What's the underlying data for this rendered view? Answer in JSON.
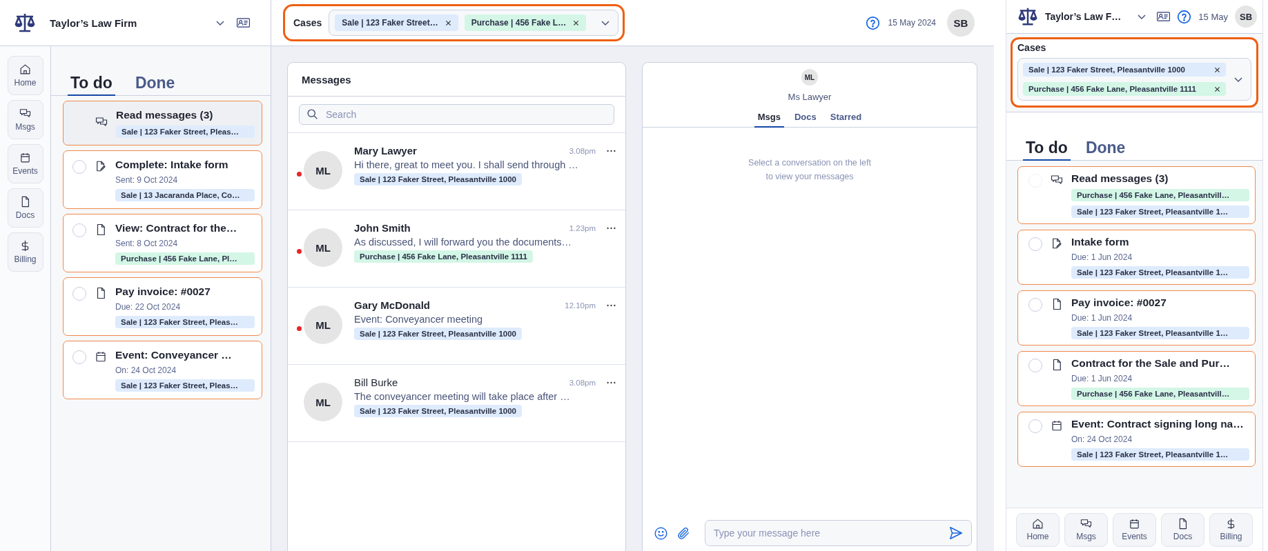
{
  "desktop": {
    "brand": {
      "name": "Taylor’s Law Firm"
    },
    "nav": [
      {
        "kind": "home",
        "label": "Home"
      },
      {
        "kind": "messages",
        "label": "Msgs"
      },
      {
        "kind": "events",
        "label": "Events"
      },
      {
        "kind": "docs",
        "label": "Docs"
      },
      {
        "kind": "billing",
        "label": "Billing"
      }
    ],
    "tabs": [
      {
        "label": "To do",
        "selected": true
      },
      {
        "label": "Done",
        "selected": false
      }
    ],
    "todos": [
      {
        "kind": "messages",
        "selected": true,
        "title": "Read messages (3)",
        "tags": [
          {
            "kind": "sale",
            "text": "Sale | 123 Faker Street, Pleas…"
          }
        ]
      },
      {
        "kind": "form",
        "selected": false,
        "title": "Complete: Intake form",
        "subtitle": "Sent: 9 Oct 2024",
        "tags": [
          {
            "kind": "sale",
            "text": "Sale | 13 Jacaranda Place, Co…"
          }
        ]
      },
      {
        "kind": "document",
        "selected": false,
        "title": "View: Contract for the…",
        "subtitle": "Sent: 8 Oct 2024",
        "tags": [
          {
            "kind": "purchase",
            "text": "Purchase | 456 Fake Lane, Pl…"
          }
        ]
      },
      {
        "kind": "document",
        "selected": false,
        "title": "Pay invoice: #0027",
        "subtitle": "Due: 22 Oct 2024",
        "tags": [
          {
            "kind": "sale",
            "text": "Sale | 123 Faker Street, Pleas…"
          }
        ]
      },
      {
        "kind": "event",
        "selected": false,
        "title": "Event: Conveyancer …",
        "subtitle": "On: 24 Oct 2024",
        "tags": [
          {
            "kind": "sale",
            "text": "Sale | 123 Faker Street, Pleas…"
          }
        ]
      }
    ],
    "cases": {
      "label": "Cases",
      "chips": [
        {
          "kind": "sale",
          "text": "Sale | 123 Faker Street…"
        },
        {
          "kind": "purchase",
          "text": "Purchase | 456 Fake L…"
        }
      ]
    },
    "date": "15 May 2024",
    "avatar": "SB",
    "messages": {
      "title": "Messages",
      "search": {
        "placeholder": "Search"
      },
      "conversations": [
        {
          "initials": "ML",
          "name": "Mary Lawyer",
          "unread": true,
          "time": "3.08pm",
          "preview": "Hi there, great to meet you. I shall send through …",
          "tag": {
            "kind": "sale",
            "text": "Sale | 123 Faker Street, Pleasantville 1000"
          }
        },
        {
          "initials": "ML",
          "name": "John Smith",
          "unread": true,
          "time": "1.23pm",
          "preview": "As discussed, I will forward you the documents…",
          "tag": {
            "kind": "purchase",
            "text": "Purchase | 456 Fake Lane, Pleasantville 1111"
          }
        },
        {
          "initials": "ML",
          "name": "Gary McDonald",
          "unread": true,
          "time": "12.10pm",
          "preview": "Event: Conveyancer meeting",
          "tag": {
            "kind": "sale",
            "text": "Sale | 123 Faker Street, Pleasantville 1000"
          }
        },
        {
          "initials": "ML",
          "name": "Bill Burke",
          "unread": false,
          "time": "3.08pm",
          "preview": "The conveyancer meeting will take place after …",
          "tag": {
            "kind": "sale",
            "text": "Sale | 123 Faker Street, Pleasantville 1000"
          }
        }
      ]
    },
    "conversation": {
      "initials": "ML",
      "name": "Ms Lawyer",
      "tabs": [
        {
          "label": "Msgs",
          "selected": true
        },
        {
          "label": "Docs",
          "selected": false
        },
        {
          "label": "Starred",
          "selected": false
        }
      ],
      "empty_lines": [
        "Select a conversation on the left",
        "to view your messages"
      ],
      "composer": {
        "placeholder": "Type your message here"
      }
    }
  },
  "mobile": {
    "brand": {
      "name": "Taylor’s Law F…"
    },
    "date": "15 May",
    "avatar": "SB",
    "cases": {
      "label": "Cases",
      "chips": [
        {
          "kind": "sale",
          "text": "Sale | 123 Faker Street, Pleasantville 1000"
        },
        {
          "kind": "purchase",
          "text": "Purchase | 456 Fake Lane, Pleasantville 1111"
        }
      ]
    },
    "tabs": [
      {
        "label": "To do",
        "selected": true
      },
      {
        "label": "Done",
        "selected": false
      }
    ],
    "todos": [
      {
        "kind": "messages",
        "selected": false,
        "title": "Read messages (3)",
        "tags": [
          {
            "kind": "purchase",
            "text": "Purchase | 456 Fake Lane, Pleasantvill…"
          },
          {
            "kind": "sale",
            "text": "Sale | 123 Faker Street, Pleasantville 1…"
          }
        ]
      },
      {
        "kind": "form",
        "selected": false,
        "title": "Intake form",
        "subtitle": "Due: 1 Jun 2024",
        "tags": [
          {
            "kind": "sale",
            "text": "Sale | 123 Faker Street, Pleasantville 1…"
          }
        ]
      },
      {
        "kind": "document",
        "selected": false,
        "title": "Pay invoice: #0027",
        "subtitle": "Due: 1 Jun 2024",
        "tags": [
          {
            "kind": "sale",
            "text": "Sale | 123 Faker Street, Pleasantville 1…"
          }
        ]
      },
      {
        "kind": "document",
        "selected": false,
        "title": "Contract for the Sale and Pur…",
        "subtitle": "Due: 1 Jun 2024",
        "tags": [
          {
            "kind": "purchase",
            "text": "Purchase | 456 Fake Lane, Pleasantvill…"
          }
        ]
      },
      {
        "kind": "event",
        "selected": false,
        "title": "Event: Contract signing long na…",
        "subtitle": "On: 24 Oct 2024",
        "tags": [
          {
            "kind": "sale",
            "text": "Sale | 123 Faker Street, Pleasantville 1…"
          }
        ]
      }
    ],
    "nav": [
      {
        "kind": "home",
        "label": "Home"
      },
      {
        "kind": "messages",
        "label": "Msgs"
      },
      {
        "kind": "events",
        "label": "Events"
      },
      {
        "kind": "docs",
        "label": "Docs"
      },
      {
        "kind": "billing",
        "label": "Billing"
      }
    ]
  }
}
